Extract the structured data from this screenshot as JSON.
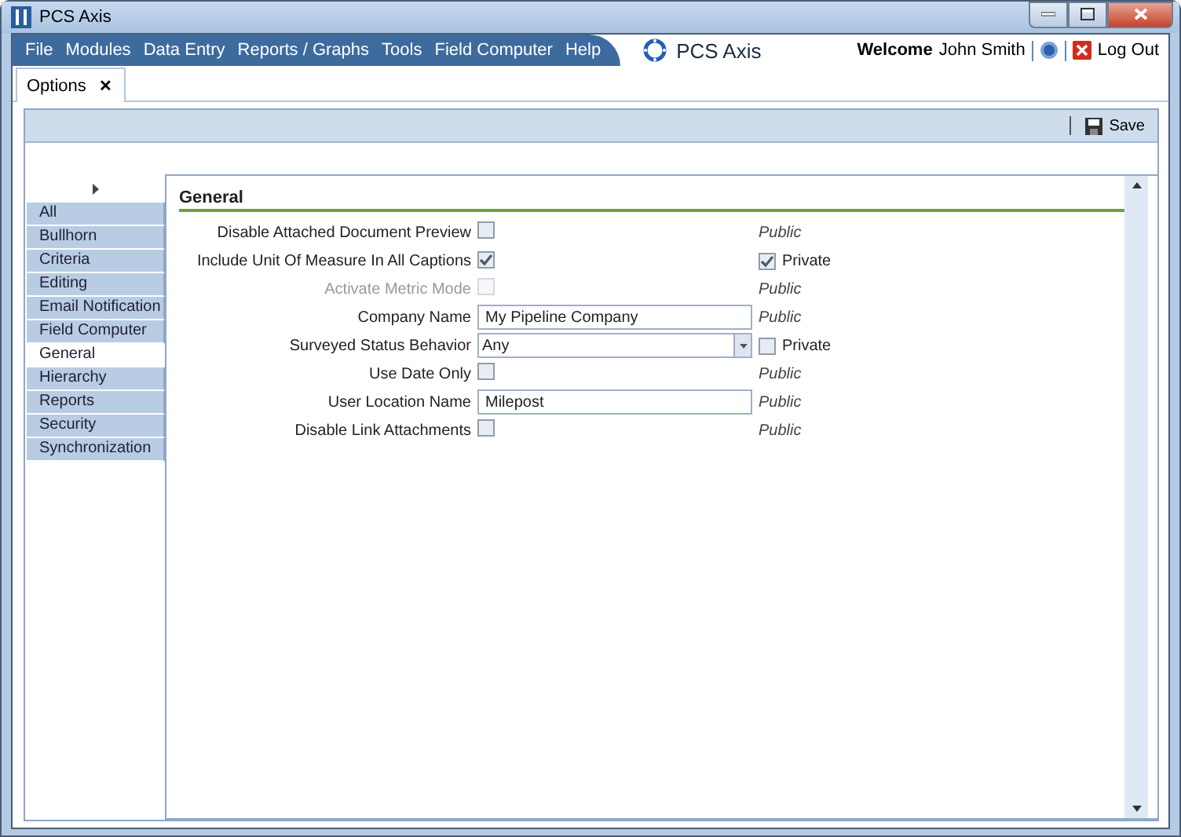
{
  "window": {
    "title": "PCS Axis"
  },
  "menu": [
    "File",
    "Modules",
    "Data Entry",
    "Reports / Graphs",
    "Tools",
    "Field Computer",
    "Help"
  ],
  "brand": "PCS Axis",
  "user": {
    "welcome": "Welcome",
    "name": "John Smith",
    "logout": "Log Out"
  },
  "tabs": [
    {
      "label": "Options",
      "close": "✕",
      "selected": true
    }
  ],
  "toolbar": {
    "save": "Save"
  },
  "sidebar": {
    "items": [
      {
        "label": "All",
        "selected": false
      },
      {
        "label": "Bullhorn",
        "selected": false
      },
      {
        "label": "Criteria",
        "selected": false
      },
      {
        "label": "Editing",
        "selected": false
      },
      {
        "label": "Email Notification",
        "selected": false
      },
      {
        "label": "Field Computer",
        "selected": false
      },
      {
        "label": "General",
        "selected": true
      },
      {
        "label": "Hierarchy",
        "selected": false
      },
      {
        "label": "Reports",
        "selected": false
      },
      {
        "label": "Security",
        "selected": false
      },
      {
        "label": "Synchronization",
        "selected": false
      }
    ]
  },
  "section": {
    "title": "General",
    "settings": [
      {
        "label": "Disable Attached Document Preview",
        "kind": "checkbox",
        "checked": false,
        "disabled": false,
        "scope": {
          "kind": "text",
          "label": "Public"
        }
      },
      {
        "label": "Include Unit Of Measure In All Captions",
        "kind": "checkbox",
        "checked": true,
        "disabled": false,
        "scope": {
          "kind": "checkbox",
          "label": "Private",
          "checked": true
        }
      },
      {
        "label": "Activate Metric Mode",
        "kind": "checkbox",
        "checked": false,
        "disabled": true,
        "scope": {
          "kind": "text",
          "label": "Public"
        }
      },
      {
        "label": "Company Name",
        "kind": "text",
        "value": "My Pipeline Company",
        "disabled": false,
        "scope": {
          "kind": "text",
          "label": "Public"
        }
      },
      {
        "label": "Surveyed Status Behavior",
        "kind": "dropdown",
        "value": "Any",
        "disabled": false,
        "scope": {
          "kind": "checkbox",
          "label": "Private",
          "checked": false
        }
      },
      {
        "label": "Use Date Only",
        "kind": "checkbox",
        "checked": false,
        "disabled": false,
        "scope": {
          "kind": "text",
          "label": "Public"
        }
      },
      {
        "label": "User Location Name",
        "kind": "text",
        "value": "Milepost",
        "disabled": false,
        "scope": {
          "kind": "text",
          "label": "Public"
        }
      },
      {
        "label": "Disable Link Attachments",
        "kind": "checkbox",
        "checked": false,
        "disabled": false,
        "scope": {
          "kind": "text",
          "label": "Public"
        }
      }
    ]
  }
}
